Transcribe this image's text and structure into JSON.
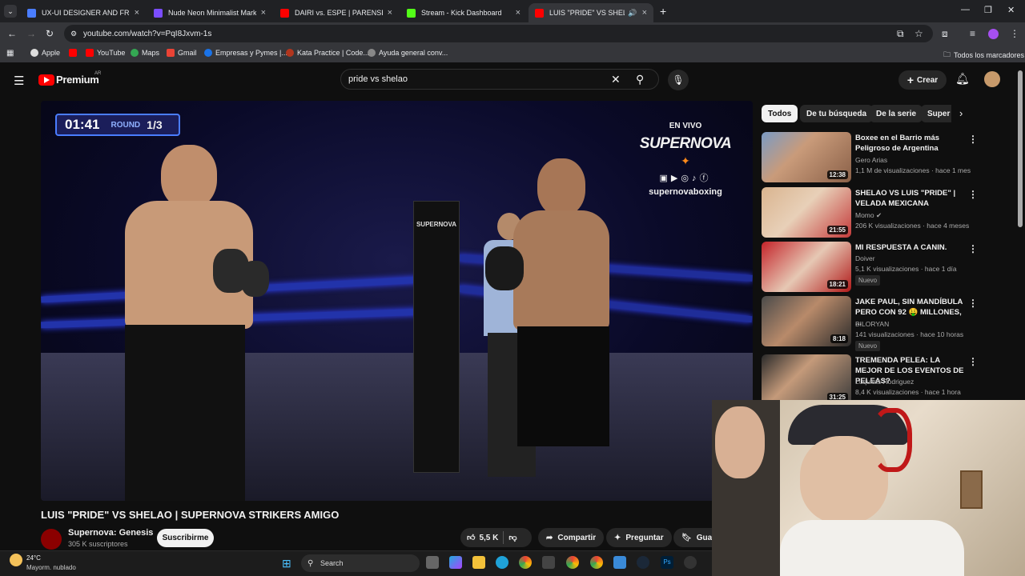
{
  "browser": {
    "tabs": [
      {
        "title": "UX-UI DESIGNER AND FRONTE",
        "color": "#4a7dff"
      },
      {
        "title": "Nude Neon Minimalist Marketi",
        "color": "#7b4dff"
      },
      {
        "title": "DAIRI vs. ESPE | PARENSE DE M",
        "color": "#ff0000"
      },
      {
        "title": "Stream - Kick Dashboard",
        "color": "#53fc18"
      },
      {
        "title": "LUIS \"PRIDE\" VS SHELAO | S",
        "color": "#ff0000"
      }
    ],
    "url": "youtube.com/watch?v=PqI8Jxvm-1s",
    "bookmarks": [
      "Apple",
      "YouTube",
      "Maps",
      "Gmail",
      "Empresas y Pymes |...",
      "Kata Practice | Code...",
      "Ayuda general conv..."
    ],
    "all_bookmarks": "Todos los marcadores"
  },
  "youtube": {
    "logo_text": "Premium",
    "region": "AR",
    "search_query": "pride vs shelao",
    "create_label": "Crear"
  },
  "video": {
    "timer": "01:41",
    "round_label": "ROUND",
    "round_value": "1/3",
    "live_label": "EN VIVO",
    "brand": "SUPERNOVA",
    "handle": "supernovaboxing",
    "corner_text": "SUPERNOVA"
  },
  "watch": {
    "title": "LUIS \"PRIDE\" VS SHELAO | SUPERNOVA STRIKERS AMIGO",
    "channel": "Supernova: Genesis",
    "subscribers": "305 K suscriptores",
    "subscribe_label": "Suscribirme",
    "likes": "5,5 K",
    "share_label": "Compartir",
    "ask_label": "Preguntar",
    "save_label": "Guar"
  },
  "sidebar": {
    "chips": [
      "Todos",
      "De tu búsqueda",
      "De la serie",
      "Super"
    ],
    "videos": [
      {
        "title": "Boxee en el Barrio más Peligroso de Argentina",
        "channel": "Gero Arias",
        "meta": "1,1 M de visualizaciones · hace 1 mes",
        "duration": "12:38",
        "badge": ""
      },
      {
        "title": "SHELAO VS LUIS \"PRIDE\" | VELADA MEXICANA",
        "channel": "Momo",
        "meta": "206 K visualizaciones · hace 4 meses",
        "duration": "21:55",
        "badge": ""
      },
      {
        "title": "MI RESPUESTA A CANIN.",
        "channel": "Doiver",
        "meta": "5,1 K visualizaciones · hace 1 día",
        "duration": "18:21",
        "badge": "Nuevo"
      },
      {
        "title": "JAKE PAUL, SIN MANDÍBULA PERO CON 92 🤑 MILLONES, ...",
        "channel": "BILORYAN",
        "meta": "141 visualizaciones · hace 10 horas",
        "duration": "8:18",
        "badge": "Nuevo"
      },
      {
        "title": "TREMENDA PELEA: LA MEJOR DE LOS EVENTOS DE PELEAS?",
        "channel": "Luquitas Rodriguez",
        "meta": "8,4 K visualizaciones · hace 1 hora",
        "duration": "31:25",
        "badge": ""
      }
    ]
  },
  "taskbar": {
    "temperature": "24°C",
    "weather": "Mayorm. nublado",
    "search_label": "Search"
  }
}
